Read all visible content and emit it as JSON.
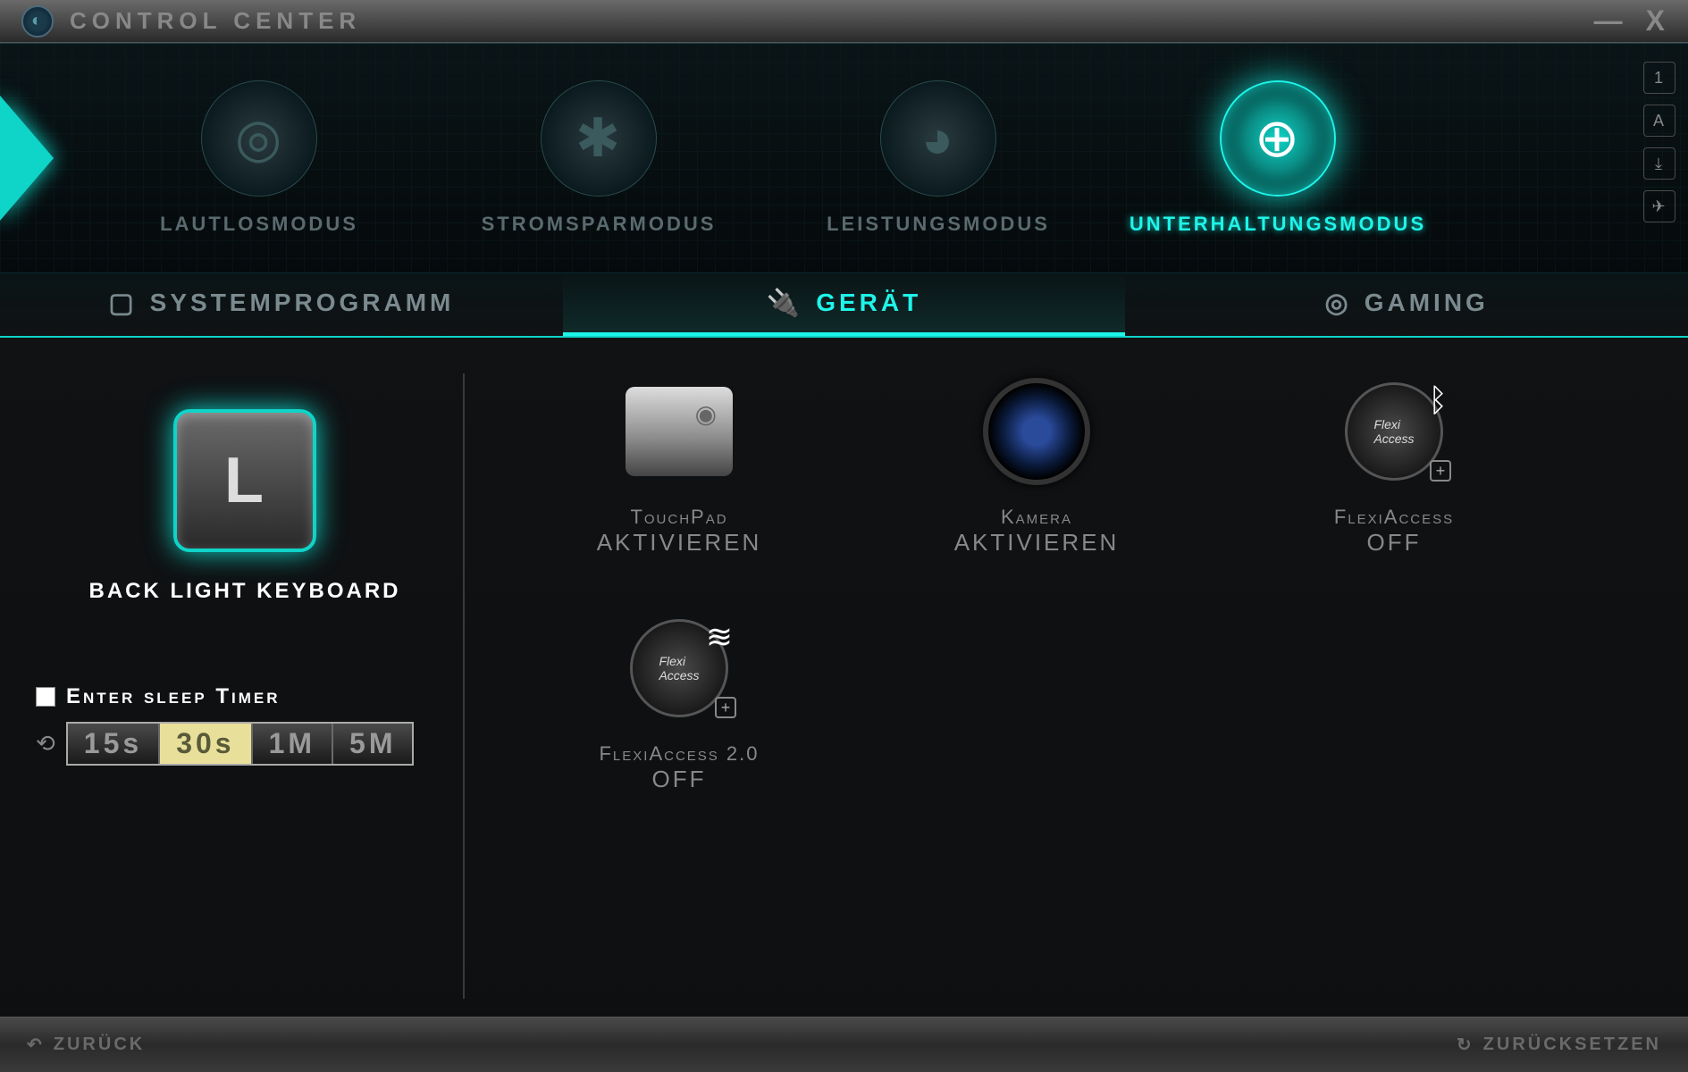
{
  "app": {
    "title": "Control Center"
  },
  "window_buttons": {
    "minimize": "—",
    "close": "X"
  },
  "side_indicators": [
    "1",
    "A",
    "⤓",
    "✈"
  ],
  "modes": [
    {
      "label": "Lautlosmodus",
      "icon": "◎",
      "active": false
    },
    {
      "label": "Stromsparmodus",
      "icon": "✱",
      "active": false
    },
    {
      "label": "Leistungsmodus",
      "icon": "◕",
      "active": false
    },
    {
      "label": "Unterhaltungsmodus",
      "icon": "⊕",
      "active": true
    }
  ],
  "tabs": [
    {
      "label": "Systemprogramm",
      "icon": "▢",
      "active": false
    },
    {
      "label": "Gerät",
      "icon": "🔌",
      "active": true
    },
    {
      "label": "Gaming",
      "icon": "◎",
      "active": false
    }
  ],
  "keyboard": {
    "key_letter": "L",
    "label": "Back Light Keyboard",
    "sleep_timer_label": "Enter sleep Timer",
    "sleep_timer_checked": false,
    "timer_options": [
      "15s",
      "30s",
      "1M",
      "5M"
    ],
    "timer_selected": "30s"
  },
  "devices": [
    {
      "name": "TouchPad",
      "status": "Aktivieren",
      "kind": "touchpad"
    },
    {
      "name": "Kamera",
      "status": "Aktivieren",
      "kind": "camera"
    },
    {
      "name": "FlexiAccess",
      "status": "OFF",
      "kind": "flexi-bt",
      "badge": "bluetooth"
    },
    {
      "name": "FlexiAccess 2.0",
      "status": "OFF",
      "kind": "flexi-wifi",
      "badge": "wifi"
    }
  ],
  "footer": {
    "back": "Zurück",
    "reset": "Zurücksetzen"
  }
}
